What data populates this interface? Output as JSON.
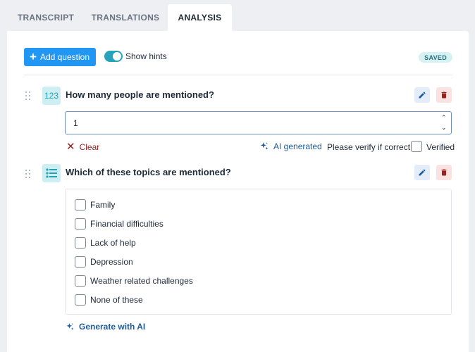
{
  "tabs": [
    {
      "label": "TRANSCRIPT"
    },
    {
      "label": "TRANSLATIONS"
    },
    {
      "label": "ANALYSIS"
    }
  ],
  "toolbar": {
    "add_label": "Add question",
    "hints_label": "Show hints",
    "hints_on": true,
    "status": "SAVED"
  },
  "questions": [
    {
      "type_icon": "number-icon",
      "icon_text": "123",
      "title": "How many people are mentioned?",
      "value": "1",
      "clear_label": "Clear",
      "ai_label": "AI generated",
      "verify_text": "Please verify if correct",
      "verified_label": "Verified",
      "verified": false
    },
    {
      "type_icon": "list-icon",
      "title": "Which of these topics are mentioned?",
      "options": [
        {
          "label": "Family",
          "checked": false
        },
        {
          "label": "Financial difficulties",
          "checked": false
        },
        {
          "label": "Lack of help",
          "checked": false
        },
        {
          "label": "Depression",
          "checked": false
        },
        {
          "label": "Weather related challenges",
          "checked": false
        },
        {
          "label": "None of these",
          "checked": false
        }
      ],
      "generate_label": "Generate with AI"
    }
  ],
  "colors": {
    "primary": "#2196f3",
    "toggle": "#26a3b8",
    "danger": "#9b2020",
    "link": "#1d5c9f",
    "saved_bg": "#d5f1f4"
  }
}
